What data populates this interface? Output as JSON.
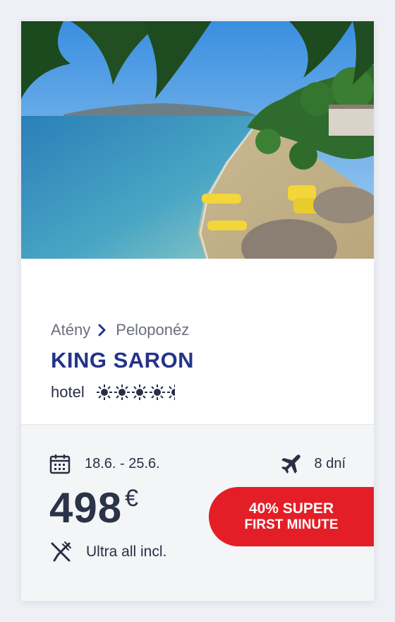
{
  "card": {
    "breadcrumb": {
      "from": "Atény",
      "to": "Peloponéz"
    },
    "title": "KING SARON",
    "type": "hotel",
    "rating_suns": 4.5,
    "dates": "18.6. - 25.6.",
    "duration": "8 dní",
    "price": {
      "amount": "498",
      "currency": "€"
    },
    "board": "Ultra all incl.",
    "badge": {
      "line1": "40% SUPER",
      "line2": "FIRST MINUTE"
    }
  },
  "icons": {
    "calendar": "calendar-icon",
    "plane": "plane-icon",
    "board": "cutlery-icon",
    "chevron": "chevron-right-icon",
    "sun": "sun-icon"
  },
  "colors": {
    "title": "#24338a",
    "badge": "#e41e26",
    "background": "#eef0f5"
  }
}
